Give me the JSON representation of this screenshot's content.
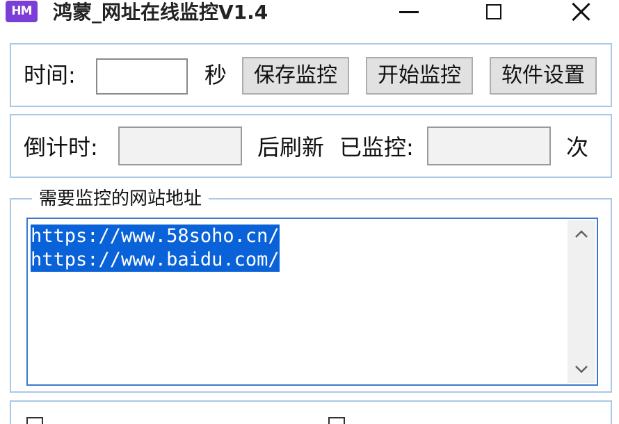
{
  "window": {
    "icon_text": "HM",
    "title": "鸿蒙_网址在线监控V1.4"
  },
  "row1": {
    "time_label": "时间:",
    "time_value": "",
    "seconds_label": "秒",
    "save_button": "保存监控",
    "start_button": "开始监控",
    "settings_button": "软件设置"
  },
  "row2": {
    "countdown_label": "倒计时:",
    "countdown_value": "",
    "refresh_label": "后刷新",
    "monitored_label": "已监控:",
    "monitored_value": "",
    "times_label": "次"
  },
  "urls": {
    "legend": "需要监控的网站地址",
    "lines": [
      "https://www.58soho.cn/",
      "https://www.baidu.com/"
    ]
  },
  "icons": {
    "scroll_up": "chevron-up-icon",
    "scroll_down": "chevron-down-icon"
  },
  "colors": {
    "app_icon": "#7b3ed6",
    "selection": "#0a62d8",
    "panel_border": "#a9c8e6"
  }
}
